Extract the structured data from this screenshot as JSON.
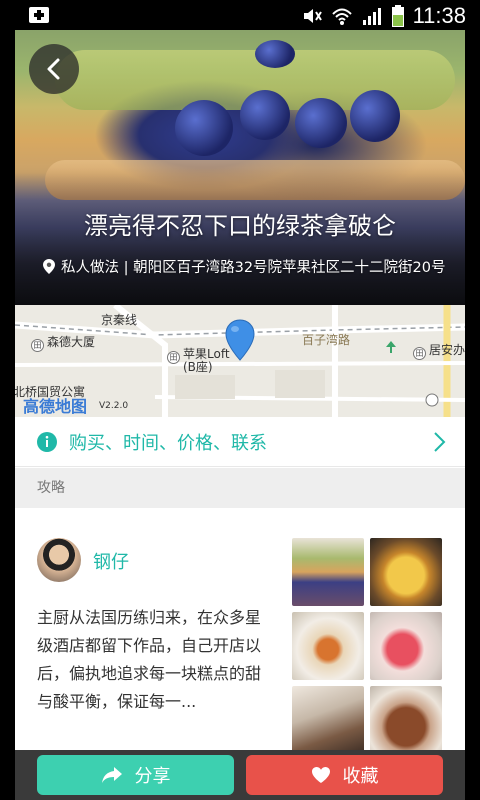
{
  "status_bar": {
    "time": "11:38"
  },
  "hero": {
    "title": "漂亮得不忍下口的绿茶拿破仑",
    "address": "私人做法 | 朝阳区百子湾路32号院苹果社区二十二院街20号"
  },
  "map": {
    "labels": {
      "jingqin_line": "京秦线",
      "baiziwan_road": "百子湾路",
      "sende_building": "森德大厦",
      "apple_loft": "苹果Loft",
      "apple_loft_b": "(B座)",
      "ju_an": "居安办",
      "guomao_apartment": "北桥国贸公寓"
    },
    "logo": "高德地图",
    "version": "V2.2.0"
  },
  "info_row": {
    "label": "购买、时间、价格、联系"
  },
  "section": {
    "title": "攻略"
  },
  "article": {
    "author": "钢仔",
    "body": "主厨从法国历练归来，在众多星级酒店都留下作品，自己开店以后，偏执地追求每一块糕点的甜与酸平衡，保证每一..."
  },
  "actions": {
    "share_label": "分享",
    "favorite_label": "收藏"
  },
  "colors": {
    "accent": "#20b8a8",
    "share": "#3dd0b0",
    "favorite": "#e8524a"
  }
}
